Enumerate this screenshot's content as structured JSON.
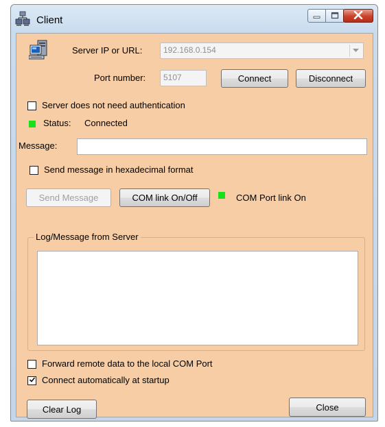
{
  "window": {
    "title": "Client"
  },
  "server": {
    "ip_label": "Server IP or URL:",
    "ip_value": "192.168.0.154",
    "port_label": "Port number:",
    "port_value": "5107",
    "connect_label": "Connect",
    "disconnect_label": "Disconnect"
  },
  "auth": {
    "no_auth_label": "Server does not need authentication",
    "no_auth_checked": false
  },
  "status": {
    "label": "Status:",
    "value": "Connected",
    "led_color": "#19e019"
  },
  "message": {
    "label": "Message:",
    "value": ""
  },
  "hex": {
    "label": "Send message in hexadecimal format",
    "checked": false
  },
  "actions": {
    "send_label": "Send Message",
    "com_toggle_label": "COM link On/Off",
    "com_status": "COM Port link On",
    "com_led_color": "#19e019"
  },
  "log": {
    "title": "Log/Message from Server",
    "content": ""
  },
  "options": {
    "forward_label": "Forward remote data to the local COM Port",
    "forward_checked": false,
    "auto_connect_label": "Connect automatically at startup",
    "auto_connect_checked": true
  },
  "footer": {
    "clear_label": "Clear Log",
    "close_label": "Close"
  },
  "icons": {
    "app": "network-computer-icon",
    "server": "computer-terminal-icon",
    "minimize": "minimize-icon",
    "maximize": "maximize-icon",
    "close": "close-icon",
    "dropdown": "chevron-down-icon",
    "check": "checkmark-icon"
  },
  "colors": {
    "client_bg": "#f6cda4",
    "titlebar": "#c9dcee",
    "close_button": "#c9412a"
  }
}
